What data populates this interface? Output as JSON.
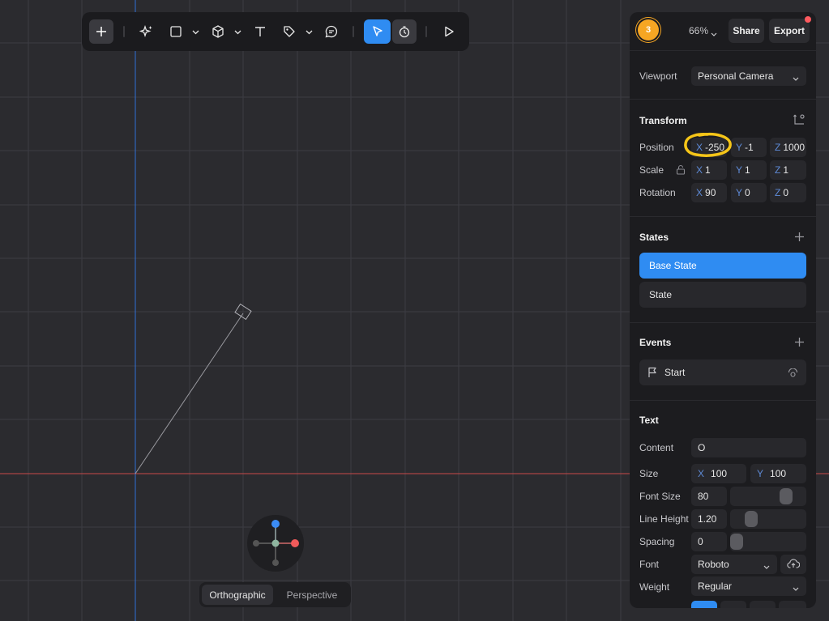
{
  "toolbar": {
    "tools": [
      "plus-icon",
      "sparkle-icon",
      "rectangle-icon",
      "cube-icon",
      "text-icon",
      "pen-icon",
      "comment-icon",
      "pointer-icon",
      "hand-icon",
      "play-icon"
    ],
    "active_tool": "pointer"
  },
  "header": {
    "avatar_initial": "3",
    "zoom": "66%",
    "share_label": "Share",
    "export_label": "Export"
  },
  "viewport": {
    "label": "Viewport",
    "value": "Personal Camera"
  },
  "transform": {
    "title": "Transform",
    "position": {
      "label": "Position",
      "x_axis": "X",
      "x": "-250",
      "y_axis": "Y",
      "y": "-1",
      "z_axis": "Z",
      "z": "1000"
    },
    "scale": {
      "label": "Scale",
      "x_axis": "X",
      "x": "1",
      "y_axis": "Y",
      "y": "1",
      "z_axis": "Z",
      "z": "1"
    },
    "rotation": {
      "label": "Rotation",
      "x_axis": "X",
      "x": "90",
      "y_axis": "Y",
      "y": "0",
      "z_axis": "Z",
      "z": "0"
    }
  },
  "states": {
    "title": "States",
    "items": [
      "Base State",
      "State"
    ]
  },
  "events": {
    "title": "Events",
    "items": [
      "Start"
    ]
  },
  "text": {
    "title": "Text",
    "content": {
      "label": "Content",
      "value": "O"
    },
    "size": {
      "label": "Size",
      "x_axis": "X",
      "x": "100",
      "y_axis": "Y",
      "y": "100"
    },
    "font_size": {
      "label": "Font Size",
      "value": "80"
    },
    "line_height": {
      "label": "Line Height",
      "value": "1.20"
    },
    "spacing": {
      "label": "Spacing",
      "value": "0"
    },
    "font": {
      "label": "Font",
      "value": "Roboto"
    },
    "weight": {
      "label": "Weight",
      "value": "Regular"
    }
  },
  "view_modes": {
    "items": [
      "Orthographic",
      "Perspective"
    ],
    "active": "Orthographic"
  },
  "colors": {
    "accent": "#2f8cf2",
    "annotation": "#f5c518",
    "x_axis_line": "#c94a4a",
    "y_axis_line": "#2f6fd6",
    "avatar": "#f6a623"
  }
}
